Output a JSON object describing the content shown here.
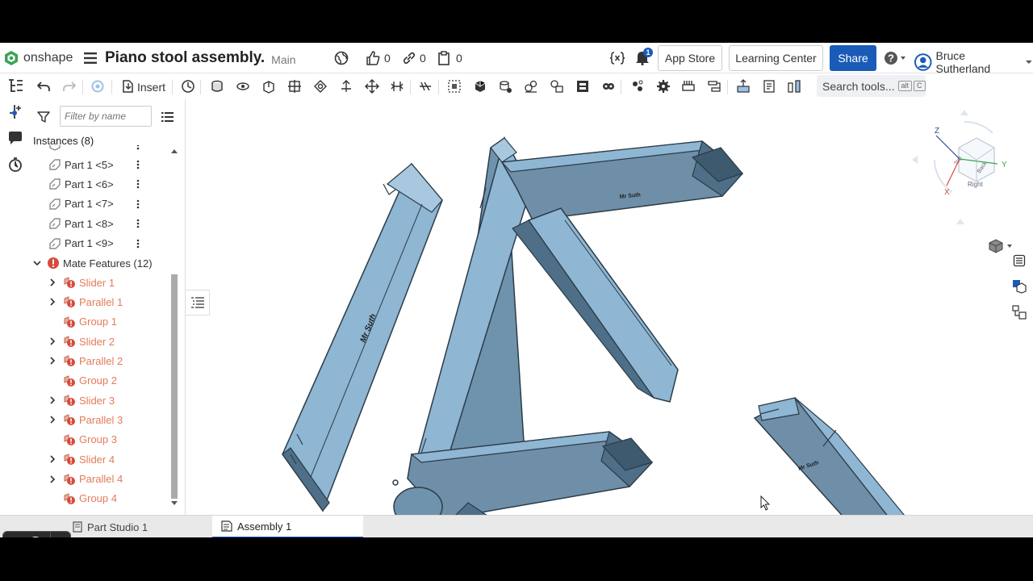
{
  "app": {
    "logo_text": "onshape",
    "document_title": "Piano stool assembly.",
    "branch": "Main",
    "likes_count": "0",
    "links_count": "0",
    "versions_count": "0",
    "notifications_badge": "1",
    "app_store_label": "App Store",
    "learning_center_label": "Learning Center",
    "share_label": "Share",
    "user_name": "Bruce Sutherland"
  },
  "toolbar": {
    "insert_label": "Insert",
    "search_placeholder": "Search tools...",
    "search_shortcut_1": "alt",
    "search_shortcut_2": "C"
  },
  "panel": {
    "filter_placeholder": "Filter by name",
    "instances_heading": "Instances (8)",
    "parts": [
      {
        "label": "Part 1 <5>"
      },
      {
        "label": "Part 1 <6>"
      },
      {
        "label": "Part 1 <7>"
      },
      {
        "label": "Part 1 <8>"
      },
      {
        "label": "Part 1 <9>"
      }
    ],
    "mate_features_label": "Mate Features (12)",
    "mates": [
      {
        "label": "Slider 1",
        "type": "slider"
      },
      {
        "label": "Parallel 1",
        "type": "parallel"
      },
      {
        "label": "Group 1",
        "type": "group"
      },
      {
        "label": "Slider 2",
        "type": "slider"
      },
      {
        "label": "Parallel 2",
        "type": "parallel"
      },
      {
        "label": "Group 2",
        "type": "group"
      },
      {
        "label": "Slider 3",
        "type": "slider"
      },
      {
        "label": "Parallel 3",
        "type": "parallel"
      },
      {
        "label": "Group 3",
        "type": "group"
      },
      {
        "label": "Slider 4",
        "type": "slider"
      },
      {
        "label": "Parallel 4",
        "type": "parallel"
      },
      {
        "label": "Group 4",
        "type": "group"
      }
    ]
  },
  "viewport": {
    "engraving_text": "Mr Suth",
    "view_cube": {
      "z": "Z",
      "y": "Y",
      "x": "X",
      "right": "Right",
      "back": "Back",
      "top": "Top"
    }
  },
  "tabs": [
    {
      "label": "Part Studio 1",
      "active": false
    },
    {
      "label": "Assembly 1",
      "active": true
    }
  ],
  "colors": {
    "brand_blue": "#1a5bb8",
    "part_light": "#8fb6d3",
    "part_dark": "#4e6f87",
    "mate_error": "#e37b5a"
  }
}
